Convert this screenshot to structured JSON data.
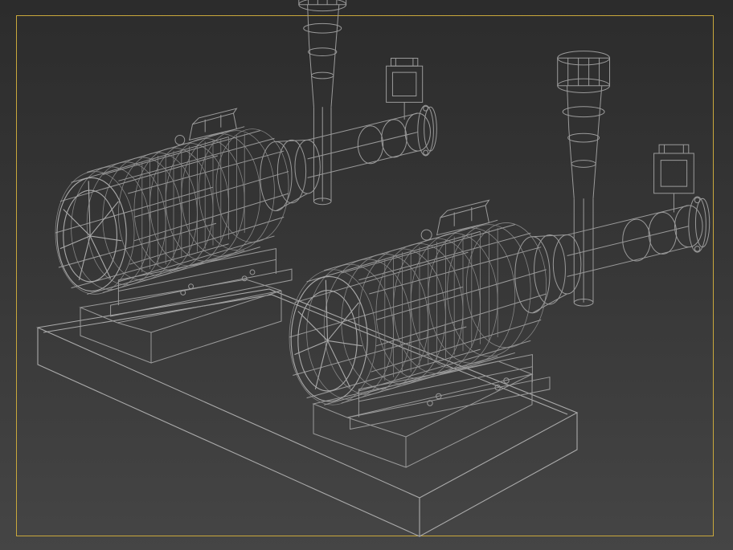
{
  "viewport": {
    "border_color": "#c9a83c",
    "background_top": "#2c2c2c",
    "background_bottom": "#454545",
    "wire_color": "#9a9a9a"
  },
  "scene": {
    "render_mode": "wireframe",
    "object_count": 2
  }
}
